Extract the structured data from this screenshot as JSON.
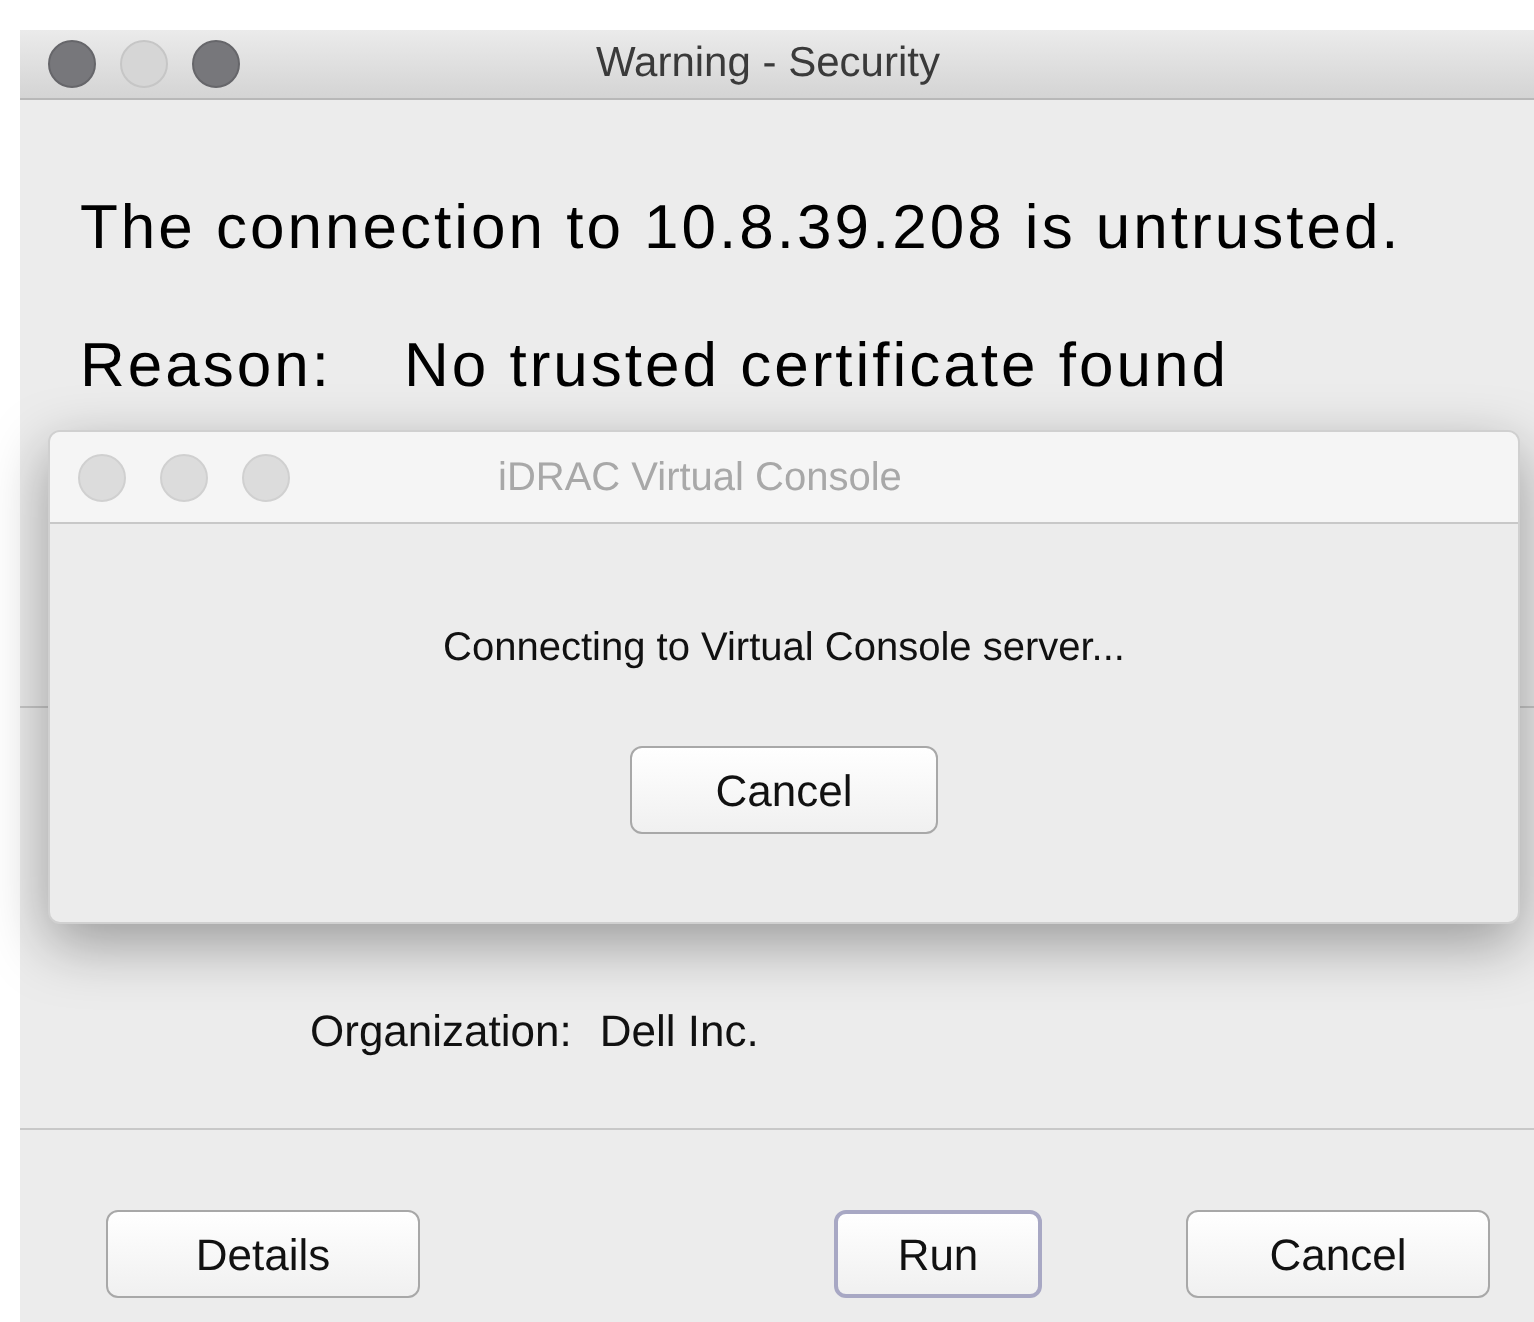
{
  "window": {
    "title": "Warning - Security",
    "active": true,
    "lights": [
      {
        "disabled": false
      },
      {
        "disabled": true
      },
      {
        "disabled": false
      }
    ]
  },
  "message": "The connection to 10.8.39.208 is untrusted.",
  "reason": {
    "label": "Reason:",
    "value": "No trusted certificate found"
  },
  "certificate": [
    {
      "label": "Organization:",
      "value": "Dell Inc."
    }
  ],
  "buttons": [
    {
      "label": "Details",
      "default": false
    },
    {
      "label": "Run",
      "default": true
    },
    {
      "label": "Cancel",
      "default": false
    }
  ],
  "dialog": {
    "title": "iDRAC Virtual Console",
    "active": false,
    "message": "Connecting to Virtual Console server...",
    "button": "Cancel"
  }
}
